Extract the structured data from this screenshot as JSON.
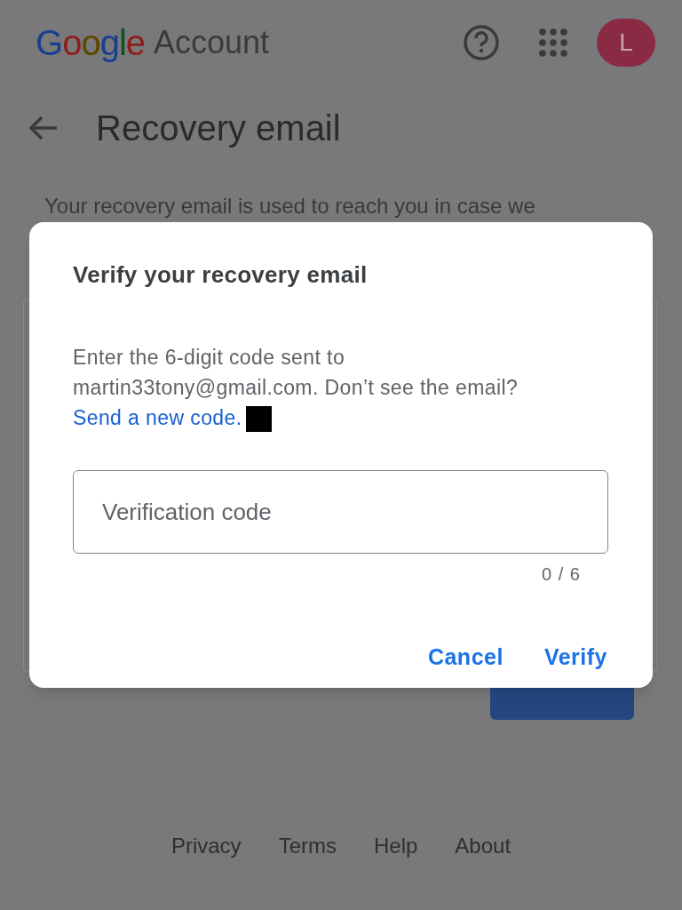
{
  "header": {
    "logo": "Google",
    "product": "Account",
    "avatar_letter": "L"
  },
  "page": {
    "title": "Recovery email",
    "description": "Your recovery email is used to reach you in case we",
    "buttons": [
      {
        "kind": "filled"
      }
    ]
  },
  "dialog": {
    "title": "Verify your recovery email",
    "message": "Enter the 6-digit code sent to martin33tony@gmail.com. Don’t see the email?",
    "link": "Send a new code.",
    "field": {
      "placeholder": "Verification code"
    },
    "counter": "0 / 6",
    "buttons": [
      {
        "label": "Cancel"
      },
      {
        "label": "Verify"
      }
    ]
  },
  "footer": {
    "links": [
      "Privacy",
      "Terms",
      "Help",
      "About"
    ]
  }
}
